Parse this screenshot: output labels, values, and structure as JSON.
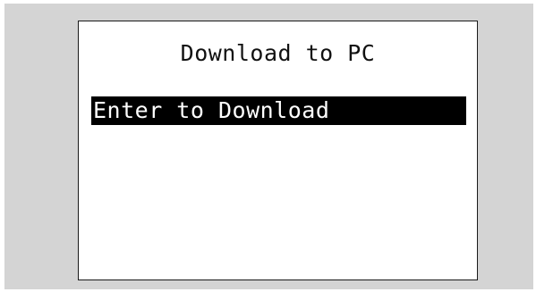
{
  "screen": {
    "title": "Download to PC",
    "menu": {
      "selected_item": "Enter to Download"
    }
  },
  "colors": {
    "frame_background": "#d4d4d4",
    "screen_background": "#ffffff",
    "highlight_background": "#000000",
    "highlight_text": "#ffffff"
  }
}
